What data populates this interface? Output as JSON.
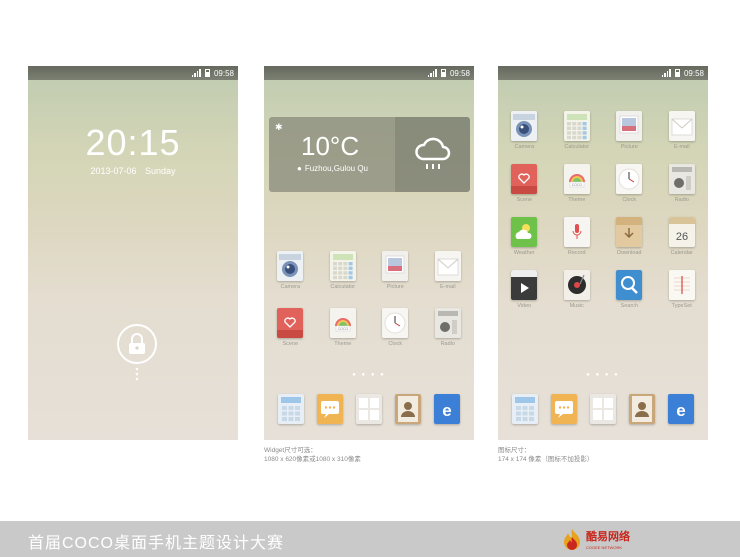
{
  "status": {
    "time": "09:58"
  },
  "lockscreen": {
    "time": "20:15",
    "date": "2013-07-06",
    "weekday": "Sunday"
  },
  "widget": {
    "temperature": "10°C",
    "location": "Fuzhou,Gulou Qu"
  },
  "home_apps": [
    {
      "label": "Camera",
      "icon": "camera-icon"
    },
    {
      "label": "Calculator",
      "icon": "calculator-icon"
    },
    {
      "label": "Picture",
      "icon": "picture-icon"
    },
    {
      "label": "E-mail",
      "icon": "email-icon"
    },
    {
      "label": "Scene",
      "icon": "scene-icon"
    },
    {
      "label": "Theme",
      "icon": "theme-icon"
    },
    {
      "label": "Clock",
      "icon": "clock-icon"
    },
    {
      "label": "Radio",
      "icon": "radio-icon"
    }
  ],
  "all_apps": [
    {
      "label": "Camera",
      "icon": "camera-icon"
    },
    {
      "label": "Calculator",
      "icon": "calculator-icon"
    },
    {
      "label": "Picture",
      "icon": "picture-icon"
    },
    {
      "label": "E-mail",
      "icon": "email-icon"
    },
    {
      "label": "Scene",
      "icon": "scene-icon"
    },
    {
      "label": "Theme",
      "icon": "theme-icon"
    },
    {
      "label": "Clock",
      "icon": "clock-icon"
    },
    {
      "label": "Radio",
      "icon": "radio-icon"
    },
    {
      "label": "Weather",
      "icon": "weather-icon"
    },
    {
      "label": "Record",
      "icon": "record-icon"
    },
    {
      "label": "Download",
      "icon": "download-icon"
    },
    {
      "label": "Calendar",
      "icon": "calendar-icon"
    },
    {
      "label": "Video",
      "icon": "video-icon"
    },
    {
      "label": "Music",
      "icon": "music-icon"
    },
    {
      "label": "Search",
      "icon": "search-icon"
    },
    {
      "label": "TypeSet",
      "icon": "typeset-icon"
    }
  ],
  "theme_icon_text": "COCO",
  "calendar_day": "26",
  "dock": [
    "phone-icon",
    "messages-icon",
    "apps-icon",
    "contacts-icon",
    "browser-icon"
  ],
  "captions": {
    "widget_line1": "Widget尺寸可选：",
    "widget_line2": "1080 x 620像素或1080 x 310像素",
    "icon_line1": "图标尺寸：",
    "icon_line2": "174 x 174 像素（图标不加投影）"
  },
  "footer": {
    "title": "首届COCO桌面手机主题设计大赛",
    "logo_text": "酷易网络",
    "logo_sub": "COOEE NETWORK"
  },
  "colors": {
    "footer_bg": "#c9c9c9",
    "logo": "#c8281e"
  }
}
